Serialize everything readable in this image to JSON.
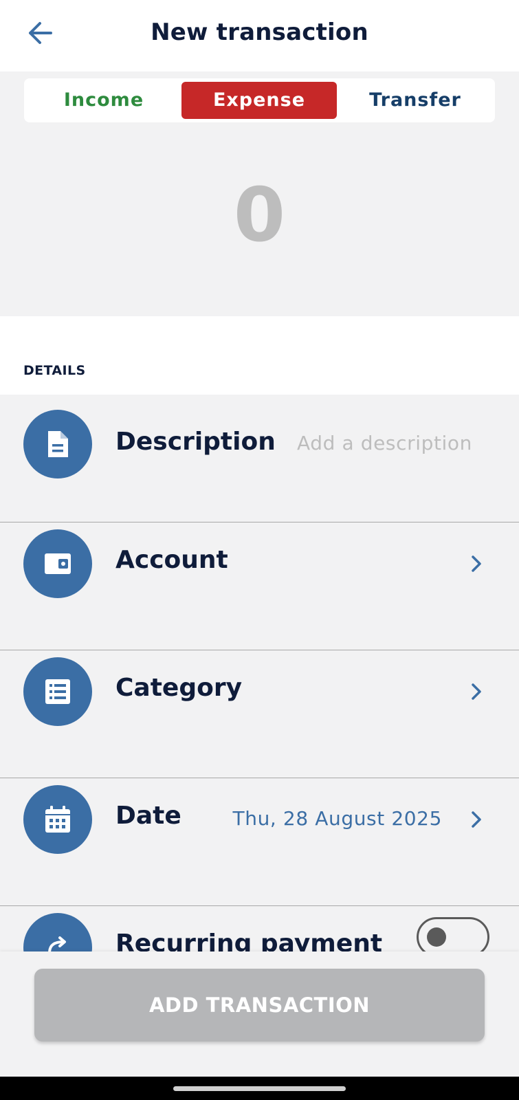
{
  "header": {
    "title": "New transaction",
    "back_icon": "arrow-left-icon"
  },
  "type_tabs": {
    "income": "Income",
    "expense": "Expense",
    "transfer": "Transfer",
    "selected": "Expense",
    "colors": {
      "income": "#2e8b3e",
      "expense_bg": "#c62828",
      "transfer": "#163e68"
    }
  },
  "amount": "0",
  "details": {
    "section_label": "DETAILS",
    "rows": [
      {
        "label": "Description",
        "value": "Add a description",
        "icon": "document-icon"
      },
      {
        "label": "Account",
        "value": "",
        "icon": "wallet-icon"
      },
      {
        "label": "Category",
        "value": "",
        "icon": "list-icon"
      },
      {
        "label": "Date",
        "value": "Thu, 28 August 2025",
        "icon": "calendar-icon"
      },
      {
        "label": "Recurring payment",
        "value": "",
        "icon": "repeat-icon",
        "toggle": false
      }
    ]
  },
  "footer": {
    "add_button": "ADD TRANSACTION"
  },
  "colors": {
    "accent": "#3b6ea5",
    "title": "#0f1c3a",
    "disabled_button": "#b5b6b8"
  }
}
